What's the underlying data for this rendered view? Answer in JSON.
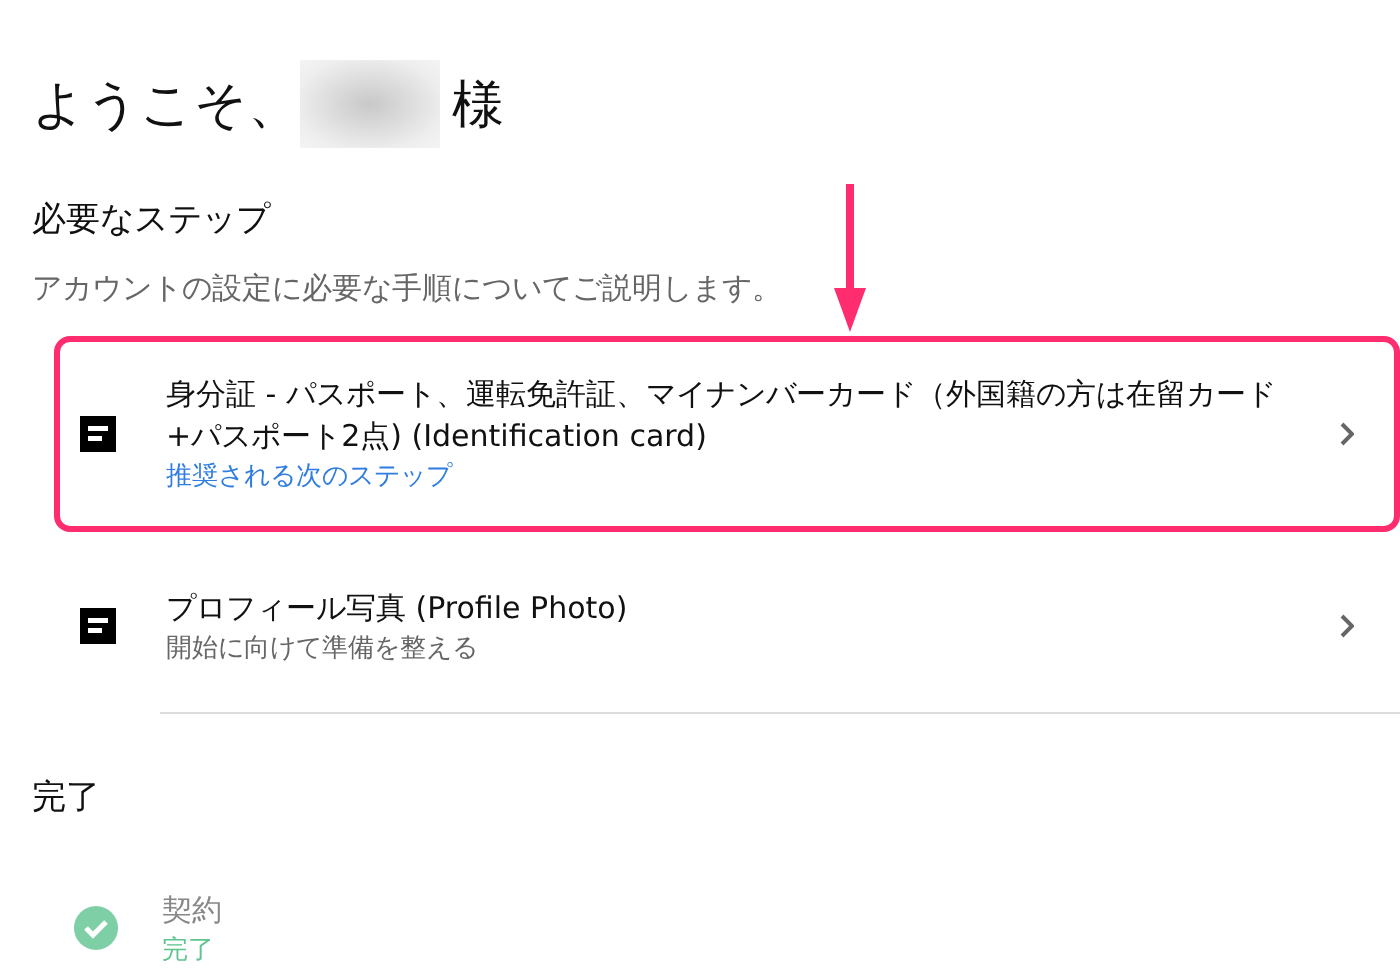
{
  "greeting": {
    "prefix": "ようこそ、",
    "suffix": "様",
    "name_redacted": true
  },
  "required_section": {
    "title": "必要なステップ",
    "description": "アカウントの設定に必要な手順についてご説明します。",
    "steps": [
      {
        "kind": "todo",
        "title": "身分証 - パスポート、運転免許証、マイナンバーカード（外国籍の方は在留カード+パスポート2点) (Identification card)",
        "subtitle": "推奨される次のステップ",
        "recommended": true,
        "highlighted": true
      },
      {
        "kind": "todo",
        "title": "プロフィール写真 (Profile Photo)",
        "subtitle": "開始に向けて準備を整える",
        "recommended": false,
        "highlighted": false
      }
    ]
  },
  "done_section": {
    "title": "完了",
    "steps": [
      {
        "kind": "done",
        "title": "契約",
        "subtitle": "完了"
      }
    ]
  },
  "annotation_arrow": true
}
